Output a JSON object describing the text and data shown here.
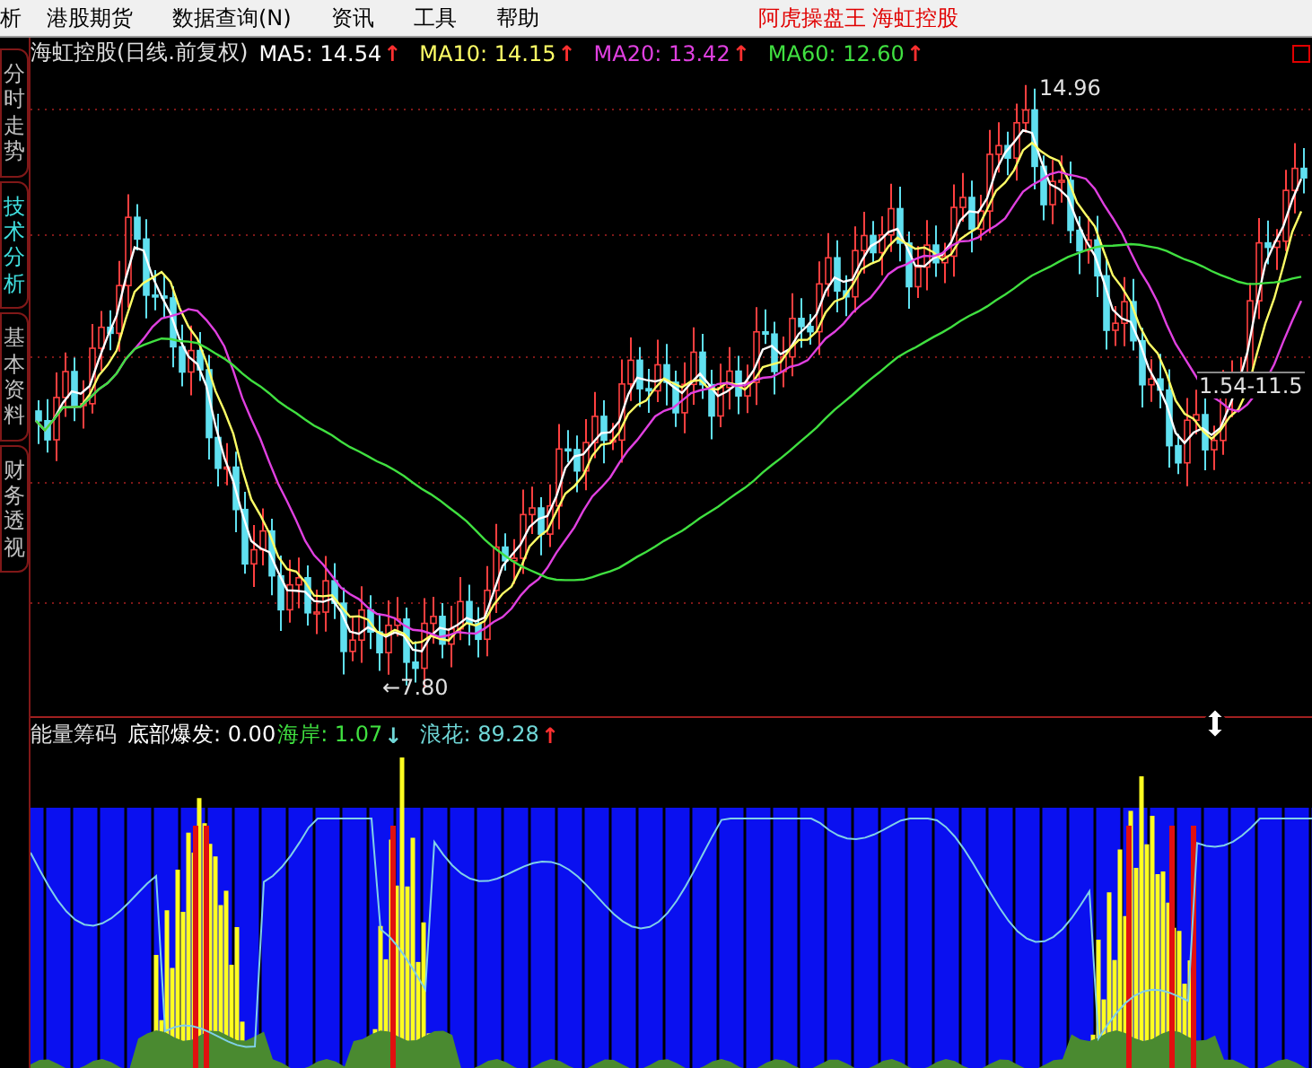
{
  "menu_bar": {
    "items": [
      {
        "label": "析"
      },
      {
        "label": "港股期货"
      },
      {
        "label": "数据查询(N)"
      },
      {
        "label": "资讯"
      },
      {
        "label": "工具"
      },
      {
        "label": "帮助"
      }
    ],
    "title": "阿虎操盘王  海虹控股"
  },
  "side_tabs": [
    {
      "label": "分时走势",
      "selected": false
    },
    {
      "label": "技术分析",
      "selected": true
    },
    {
      "label": "基本资料",
      "selected": false
    },
    {
      "label": "财务透视",
      "selected": false
    }
  ],
  "main_chart": {
    "title": "海虹控股(日线.前复权)",
    "legend": [
      {
        "label": "MA5: 14.54",
        "arrow": "↑",
        "rising": true,
        "color": "#ffffff"
      },
      {
        "label": "MA10: 14.15",
        "arrow": "↑",
        "rising": true,
        "color": "#ffff66"
      },
      {
        "label": "MA20: 13.42",
        "arrow": "↑",
        "rising": true,
        "color": "#e040e0"
      },
      {
        "label": "MA60: 12.60",
        "arrow": "↑",
        "rising": true,
        "color": "#40e040"
      }
    ],
    "high_label": "14.96",
    "low_label": "←7.80",
    "range_label": "1.54-11.5"
  },
  "indicator": {
    "title": "能量筹码",
    "legend": [
      {
        "label": "底部爆发: 0.00",
        "color": "#ffffff"
      },
      {
        "label": "海岸: 1.07",
        "arrow": "↓",
        "rising": false,
        "color": "#40e040"
      },
      {
        "label": "浪花: 89.28",
        "arrow": "↑",
        "rising": true,
        "color": "#70d8d8"
      }
    ]
  }
}
